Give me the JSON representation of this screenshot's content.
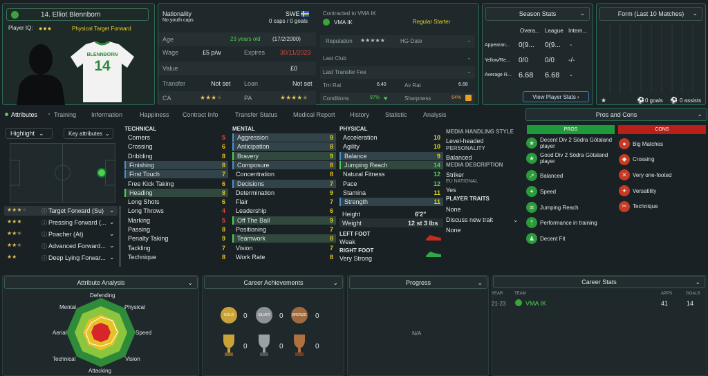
{
  "player": {
    "name": "14. Elliot Blennborn",
    "iq_label": "Player IQ:",
    "role": "Physical Target Forward",
    "shirt_name": "BLENNBORN",
    "shirt_number": "14"
  },
  "info": {
    "nationality_label": "Nationality",
    "nationality_value": "SWE",
    "youth_caps": "No youth caps",
    "caps": "0 caps / 0 goals",
    "age_label": "Age",
    "age_value": "23 years old",
    "dob": "(17/2/2000)",
    "wage_label": "Wage",
    "wage_value": "£5 p/w",
    "expires_label": "Expires",
    "expires_value": "30/11/2023",
    "value_label": "Value",
    "value_value": "£0",
    "transfer_label": "Transfer",
    "transfer_value": "Not set",
    "loan_label": "Loan",
    "loan_value": "Not set",
    "ca_label": "CA",
    "pa_label": "PA"
  },
  "contract": {
    "contracted_label": "Contracted to VMA IK",
    "club": "VMA IK",
    "status": "Regular Starter",
    "reputation_label": "Reputation",
    "hg_label": "HG-Date",
    "hg_value": "-",
    "last_club_label": "Last Club",
    "last_club_value": "-",
    "last_fee_label": "Last Transfer Fee",
    "last_fee_value": "-",
    "trn_label": "Trn Rat",
    "trn_value": "6.40",
    "av_label": "Av Rat",
    "av_value": "6.68",
    "cond_label": "Conditions",
    "cond_value": "97%",
    "sharp_label": "Sharpness",
    "sharp_value": "64%"
  },
  "season": {
    "title": "Season Stats",
    "cols": [
      "Overa...",
      "League",
      "Intern..."
    ],
    "rows": [
      {
        "label": "Appearan...",
        "v": [
          "0(9...",
          "0(9...",
          "-"
        ]
      },
      {
        "label": "Yellow/Re...",
        "v": [
          "0/0",
          "0/0",
          "-/-"
        ]
      },
      {
        "label": "Average R...",
        "v": [
          "6.68",
          "6.68",
          "-"
        ]
      }
    ],
    "button": "View Player Stats"
  },
  "form": {
    "title": "Form (Last 10 Matches)",
    "goals": "0 goals",
    "assists": "0 assists"
  },
  "tabs": [
    "Attributes",
    "Training",
    "Information",
    "Happiness",
    "Contract Info",
    "Transfer Status",
    "Medical Report",
    "History",
    "Statistic",
    "Analysis"
  ],
  "controls": {
    "highlight": "Highlight",
    "key": "Key attributes"
  },
  "roles": [
    {
      "name": "Target Forward (Su)"
    },
    {
      "name": "Pressing Forward (..."
    },
    {
      "name": "Poacher (At)"
    },
    {
      "name": "Advanced Forward..."
    },
    {
      "name": "Deep Lying Forwar..."
    }
  ],
  "technical": {
    "title": "TECHNICAL",
    "items": [
      [
        "Corners",
        "5"
      ],
      [
        "Crossing",
        "6"
      ],
      [
        "Dribbling",
        "8"
      ],
      [
        "Finishing",
        "8"
      ],
      [
        "First Touch",
        "7"
      ],
      [
        "Free Kick Taking",
        "6"
      ],
      [
        "Heading",
        "8"
      ],
      [
        "Long Shots",
        "6"
      ],
      [
        "Long Throws",
        "4"
      ],
      [
        "Marking",
        "5"
      ],
      [
        "Passing",
        "8"
      ],
      [
        "Penalty Taking",
        "9"
      ],
      [
        "Tackling",
        "7"
      ],
      [
        "Technique",
        "8"
      ]
    ]
  },
  "mental": {
    "title": "MENTAL",
    "items": [
      [
        "Aggression",
        "9"
      ],
      [
        "Anticipation",
        "8"
      ],
      [
        "Bravery",
        "9"
      ],
      [
        "Composure",
        "8"
      ],
      [
        "Concentration",
        "8"
      ],
      [
        "Decisions",
        "7"
      ],
      [
        "Determination",
        "9"
      ],
      [
        "Flair",
        "7"
      ],
      [
        "Leadership",
        "6"
      ],
      [
        "Off The Ball",
        "9"
      ],
      [
        "Positioning",
        "7"
      ],
      [
        "Teamwork",
        "8"
      ],
      [
        "Vision",
        "7"
      ],
      [
        "Work Rate",
        "8"
      ]
    ]
  },
  "physical": {
    "title": "PHYSICAL",
    "items": [
      [
        "Acceleration",
        "10"
      ],
      [
        "Agility",
        "10"
      ],
      [
        "Balance",
        "9"
      ],
      [
        "Jumping Reach",
        "14"
      ],
      [
        "Natural Fitness",
        "12"
      ],
      [
        "Pace",
        "12"
      ],
      [
        "Stamina",
        "11"
      ],
      [
        "Strength",
        "11"
      ]
    ],
    "height_label": "Height",
    "height_value": "6'2\"",
    "weight_label": "Weight",
    "weight_value": "12 st 3 lbs",
    "left_label": "LEFT FOOT",
    "left_value": "Weak",
    "right_label": "RIGHT FOOT",
    "right_value": "Very Strong"
  },
  "media": {
    "mh_label": "MEDIA HANDLING STYLE",
    "mh_value": "Level-headed",
    "pers_label": "PERSONALITY",
    "pers_value": "Balanced",
    "desc_label": "MEDIA DESCRIPTION",
    "desc_value": "Striker",
    "eu_label": "EU NATIONAL",
    "eu_value": "Yes",
    "traits_label": "PLAYER TRAITS",
    "traits_value": "None",
    "discuss": "Discuss new trait",
    "none2": "None"
  },
  "proscons": {
    "title": "Pros and Cons",
    "pros_label": "PROS",
    "cons_label": "CONS",
    "pros": [
      "Decent Div 2 Södra Götaland player",
      "Good Div 2 Södra Götaland player",
      "Balanced",
      "Speed",
      "Jumping Reach",
      "Performance in training",
      "Decent Fit"
    ],
    "cons": [
      "Big Matches",
      "Crossing",
      "Very one-footed",
      "Versatility",
      "Technique"
    ]
  },
  "bottom": {
    "analysis": "Attribute Analysis",
    "achievements": "Career Achievements",
    "progress": "Progress",
    "career": "Career Stats",
    "na": "N/A",
    "gold": "GOLD",
    "silver": "SILVER",
    "bronze": "BRONZE",
    "zero": "0"
  },
  "radar": {
    "labels": [
      "Defending",
      "Physical",
      "Speed",
      "Vision",
      "Attacking",
      "Technical",
      "Aerial",
      "Mental"
    ]
  },
  "career": {
    "h_year": "YEAR",
    "h_team": "TEAM",
    "h_apps": "APPS",
    "h_goals": "GOALS",
    "year": "21-23",
    "team": "VMA IK",
    "apps": "41",
    "goals": "14"
  },
  "colors": {
    "accent": "#4fd14f",
    "pros": "#1f9a3a",
    "cons": "#b8201a"
  }
}
